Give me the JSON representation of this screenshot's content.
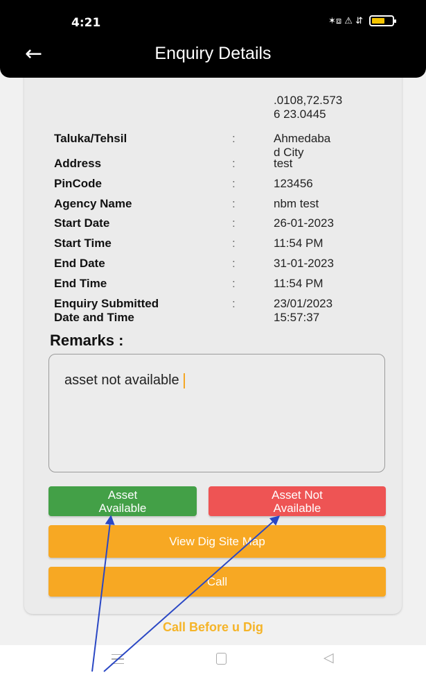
{
  "status_bar": {
    "time": "4:21",
    "icons_text": "✶⧈ ⚠ ⇵"
  },
  "header": {
    "title": "Enquiry Details",
    "back_icon": "arrow-left-icon"
  },
  "partial_value": ".0108,72.573\n6 23.0445",
  "details": [
    {
      "label": "Taluka/Tehsil",
      "value": "Ahmedaba\nd City"
    },
    {
      "label": "Address",
      "value": "test"
    },
    {
      "label": "PinCode",
      "value": "123456"
    },
    {
      "label": "Agency Name",
      "value": "nbm test"
    },
    {
      "label": "Start Date",
      "value": "26-01-2023"
    },
    {
      "label": "Start Time",
      "value": "11:54 PM"
    },
    {
      "label": "End Date",
      "value": "31-01-2023"
    },
    {
      "label": "End Time",
      "value": "11:54 PM"
    },
    {
      "label": "Enquiry Submitted\nDate and Time",
      "value": "23/01/2023\n15:57:37"
    }
  ],
  "colon": ":",
  "remarks": {
    "label": "Remarks :",
    "text": "asset not available"
  },
  "buttons": {
    "asset_available": "Asset\nAvailable",
    "asset_not_available": "Asset Not\nAvailable",
    "view_map": "View Dig Site Map",
    "call": "Call"
  },
  "footer": "Call Before u Dig",
  "colors": {
    "green": "#43a047",
    "red": "#ee5454",
    "orange": "#f7a823",
    "footer": "#f5b428",
    "arrow": "#2a47c4"
  }
}
